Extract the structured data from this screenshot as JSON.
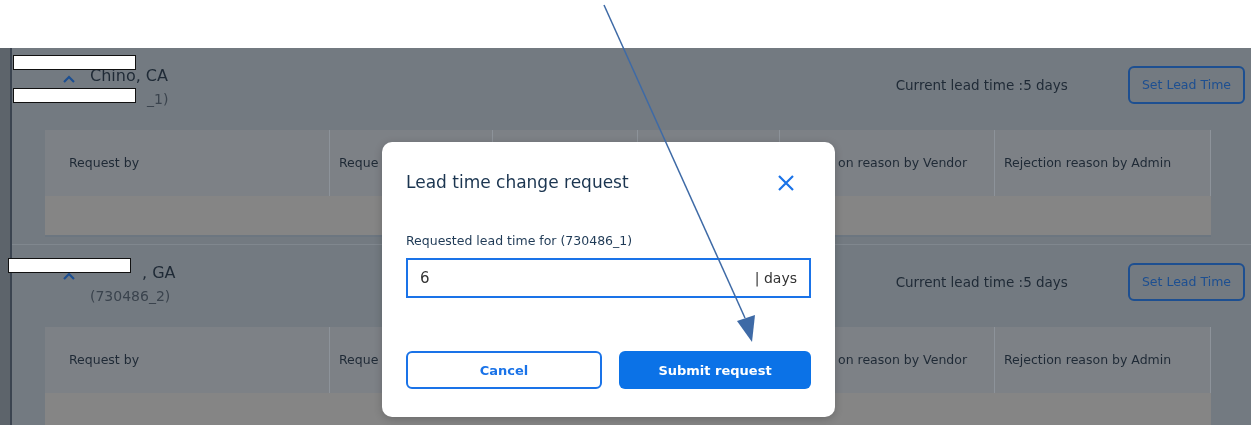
{
  "sections": [
    {
      "title": "Chino, CA",
      "id_text": "_1)",
      "current_lead_time": "Current lead time :5 days",
      "button": "Set Lead Time",
      "expanded": true,
      "redactions": [
        {
          "kind": "above_title"
        },
        {
          "kind": "id"
        }
      ],
      "columns": [
        "Request by",
        "Reque",
        "on reason by Vendor",
        "Rejection reason by Admin"
      ]
    },
    {
      "title": ", GA",
      "id_text": "(730486_2)",
      "current_lead_time": "Current lead time :5 days",
      "button": "Set Lead Time",
      "expanded": true,
      "redactions": [
        {
          "kind": "title"
        }
      ],
      "columns": [
        "Request by",
        "Reque",
        "on reason by Vendor",
        "Rejection reason by Admin"
      ]
    }
  ],
  "modal": {
    "title": "Lead time change request",
    "field_label": "Requested lead time for (730486_1)",
    "value": "6",
    "unit": "| days",
    "cancel": "Cancel",
    "submit": "Submit request"
  }
}
